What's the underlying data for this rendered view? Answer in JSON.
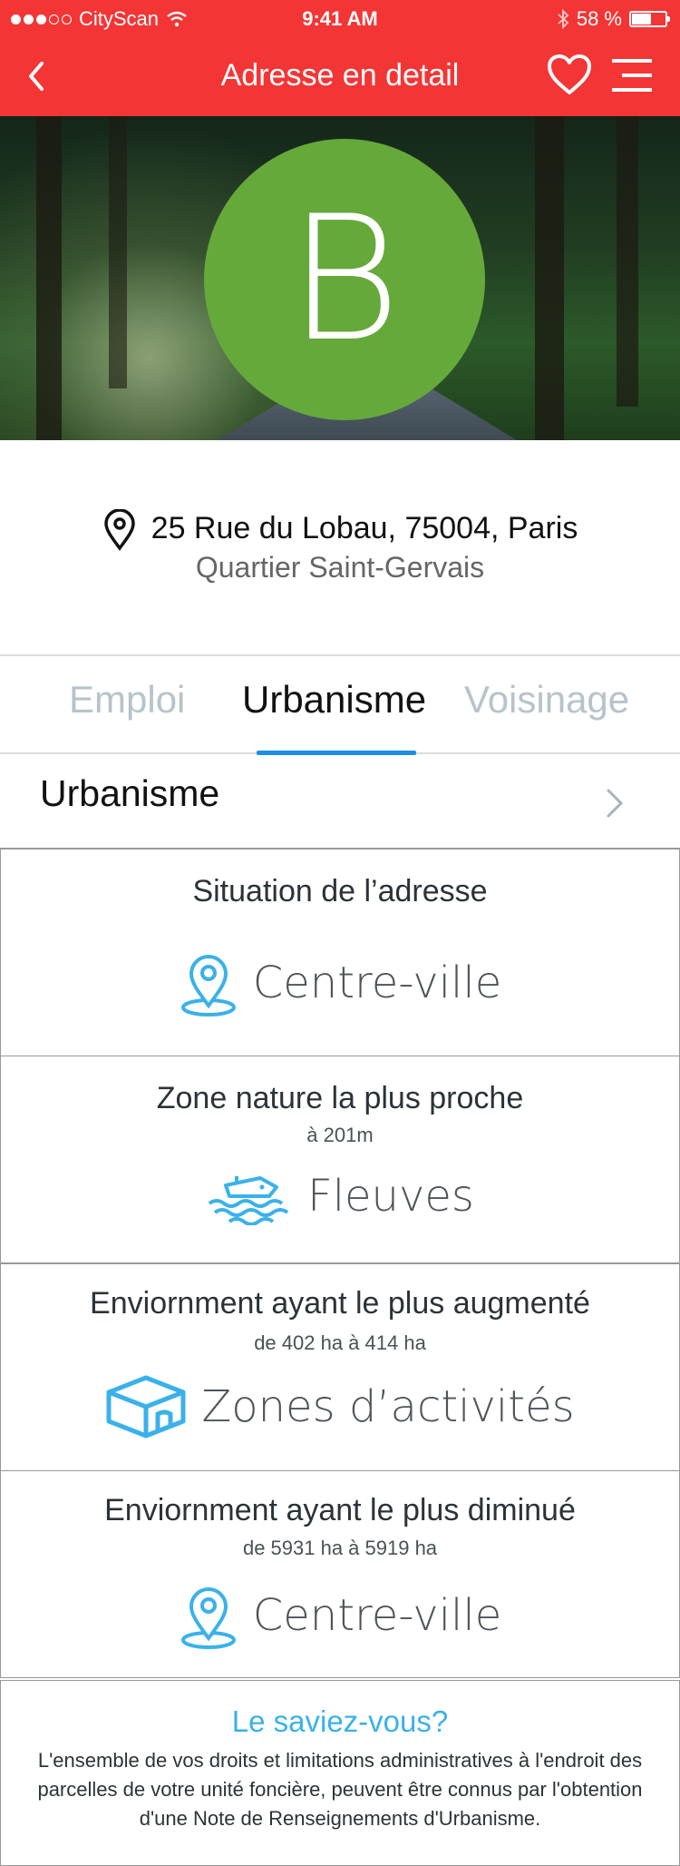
{
  "status_bar": {
    "carrier": "CityScan",
    "time": "9:41 AM",
    "battery": "58 %",
    "battery_level": 0.58
  },
  "nav": {
    "title": "Adresse en detail",
    "back_icon": "chevron-left-icon",
    "favorite_icon": "heart-icon",
    "menu_icon": "hamburger-menu-icon"
  },
  "hero": {
    "grade": "B",
    "grade_color": "#66a93b"
  },
  "address": {
    "street": "25 Rue du Lobau, 75004, Paris",
    "district": "Quartier Saint-Gervais"
  },
  "tabs": [
    {
      "label": "Emploi",
      "active": false
    },
    {
      "label": "Urbanisme",
      "active": true
    },
    {
      "label": "Voisinage",
      "active": false
    }
  ],
  "section": {
    "title": "Urbanisme"
  },
  "cards": [
    {
      "title": "Situation de l’adresse",
      "subtitle": "",
      "value": "Centre-ville",
      "icon": "map-pin-icon"
    },
    {
      "title": "Zone nature la plus proche",
      "subtitle": "à 201m",
      "value": "Fleuves",
      "icon": "boat-icon"
    },
    {
      "title": "Enviornment ayant le plus augmenté",
      "subtitle": "de 402 ha à 414 ha",
      "value": "Zones d’activités",
      "icon": "building-icon"
    },
    {
      "title": "Enviornment ayant le plus diminué",
      "subtitle": "de 5931 ha à 5919 ha",
      "value": "Centre-ville",
      "icon": "map-pin-icon"
    }
  ],
  "tip": {
    "question": "Le saviez-vous?",
    "body": "L'ensemble de vos droits et limitations administratives à l'endroit des parcelles de votre unité foncière, peuvent être connus par l'obtention d'une Note de Renseignements d'Urbanisme."
  },
  "colors": {
    "brand_red": "#f43535",
    "active_tab": "#1b8fe5",
    "icon_blue": "#3ab1ea"
  }
}
